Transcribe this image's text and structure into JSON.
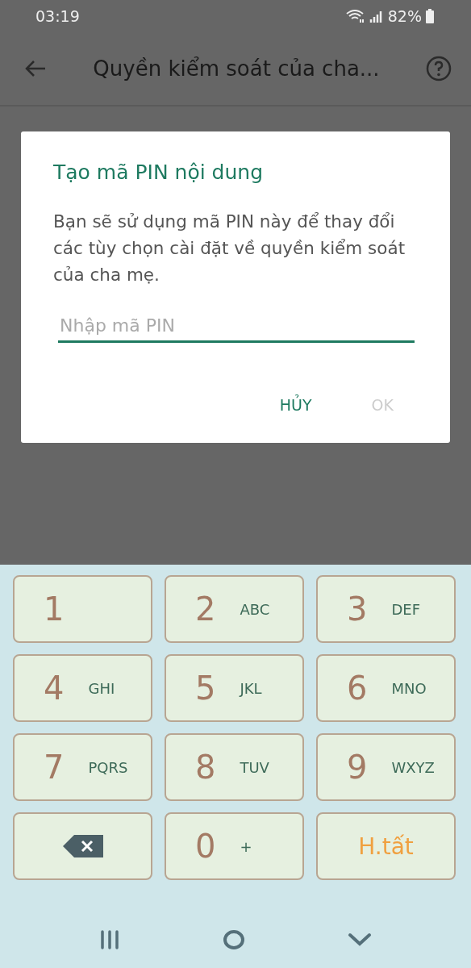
{
  "status_bar": {
    "time": "03:19",
    "battery": "82%"
  },
  "app_bar": {
    "title": "Quyền kiểm soát của cha..."
  },
  "dialog": {
    "title": "Tạo mã PIN nội dung",
    "message": "Bạn sẽ sử dụng mã PIN này để thay đổi các tùy chọn cài đặt về quyền kiểm soát của cha mẹ.",
    "pin_field": {
      "placeholder": "Nhập mã PIN"
    },
    "buttons": [
      {
        "label": "HỦY",
        "disabled": false
      },
      {
        "label": "OK",
        "disabled": true
      }
    ]
  },
  "keypad": [
    {
      "kind": "digit",
      "digit": "1"
    },
    {
      "kind": "digit",
      "digit": "2",
      "letters": "ABC"
    },
    {
      "kind": "digit",
      "digit": "3",
      "letters": "DEF"
    },
    {
      "kind": "digit",
      "digit": "4",
      "letters": "GHI"
    },
    {
      "kind": "digit",
      "digit": "5",
      "letters": "JKL"
    },
    {
      "kind": "digit",
      "digit": "6",
      "letters": "MNO"
    },
    {
      "kind": "digit",
      "digit": "7",
      "letters": "PQRS"
    },
    {
      "kind": "digit",
      "digit": "8",
      "letters": "TUV"
    },
    {
      "kind": "digit",
      "digit": "9",
      "letters": "WXYZ"
    },
    {
      "kind": "backspace"
    },
    {
      "kind": "digit",
      "digit": "0",
      "letters": "+"
    },
    {
      "kind": "done",
      "label": "H.tất"
    }
  ]
}
